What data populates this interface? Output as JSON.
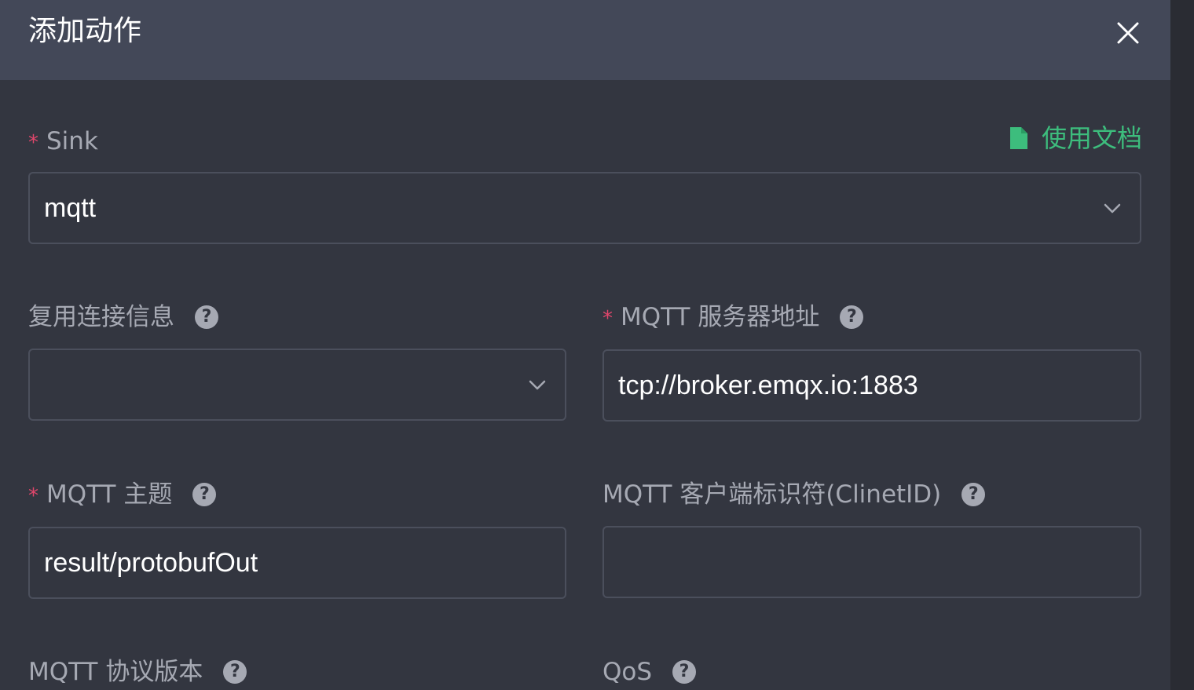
{
  "dialog": {
    "title": "添加动作"
  },
  "doc_link": {
    "label": "使用文档"
  },
  "form": {
    "sink": {
      "label": "Sink",
      "value": "mqtt"
    },
    "reuse_connection": {
      "label": "复用连接信息",
      "value": ""
    },
    "server": {
      "label": "MQTT 服务器地址",
      "value": "tcp://broker.emqx.io:1883"
    },
    "topic": {
      "label": "MQTT 主题",
      "value": "result/protobufOut"
    },
    "client_id": {
      "label": "MQTT 客户端标识符(ClinetID)",
      "value": ""
    },
    "protocol_version": {
      "label": "MQTT 协议版本"
    },
    "qos": {
      "label": "QoS"
    }
  },
  "icons": {
    "close": "close-icon",
    "doc": "document-icon",
    "help": "question-circle-icon",
    "chevron": "chevron-down-icon",
    "required": "asterisk"
  },
  "glyphs": {
    "required_mark": "*",
    "help_mark": "?"
  },
  "colors": {
    "background": "#333640",
    "header": "#434858",
    "accent_green": "#3dbd7d",
    "required_red": "#e0466b",
    "label_gray": "#a6a9b3",
    "border": "#4b4f5c"
  }
}
